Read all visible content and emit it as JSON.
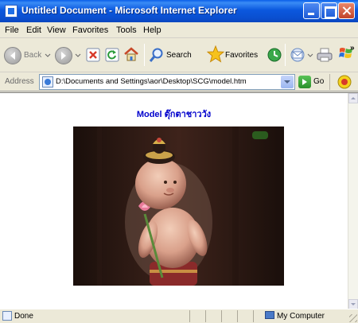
{
  "window": {
    "title": "Untitled Document - Microsoft Internet Explorer"
  },
  "menu": {
    "items": [
      "File",
      "Edit",
      "View",
      "Favorites",
      "Tools",
      "Help"
    ]
  },
  "toolbar": {
    "back_label": "Back",
    "search_label": "Search",
    "favorites_label": "Favorites",
    "icons": [
      "back-icon",
      "forward-icon",
      "stop-icon",
      "refresh-icon",
      "home-icon",
      "search-icon",
      "favorites-star-icon",
      "history-icon",
      "mail-icon",
      "print-icon"
    ]
  },
  "address": {
    "label": "Address",
    "value": "D:\\Documents and Settings\\aor\\Desktop\\SCG\\model.htm",
    "go_label": "Go"
  },
  "page": {
    "heading": "Model ตุ๊กตาชาววัง"
  },
  "status": {
    "text": "Done",
    "zone": "My Computer"
  },
  "colors": {
    "titlebar": "#0a5ee8",
    "heading": "#0000cc",
    "chrome": "#ece9d8"
  }
}
